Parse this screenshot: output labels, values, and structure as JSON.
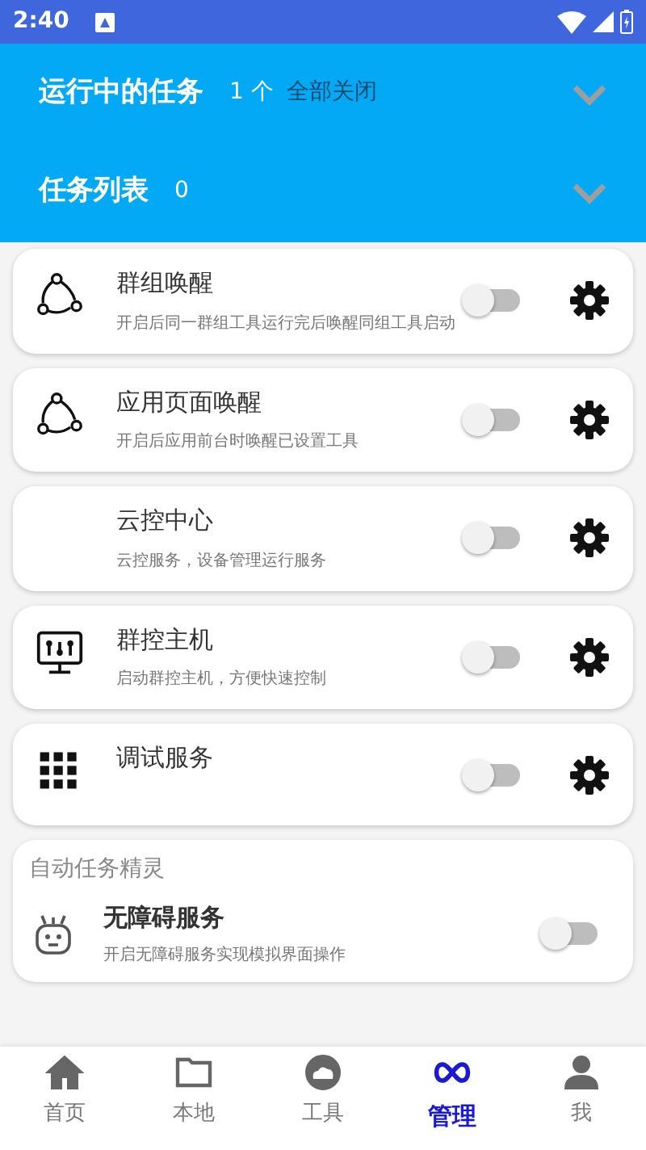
{
  "status_bar": {
    "time": "2:40"
  },
  "header": {
    "running": {
      "title": "运行中的任务",
      "count": "1 个",
      "action": "全部关闭",
      "expanded": false
    },
    "task_list": {
      "title": "任务列表",
      "count": "0",
      "expanded": false
    }
  },
  "services": [
    {
      "title": "群组唤醒",
      "description": "开启后同一群组工具运行完后唤醒同组工具启动",
      "on": false
    },
    {
      "title": "应用页面唤醒",
      "description": "开启后应用前台时唤醒已设置工具",
      "on": false
    },
    {
      "title": "云控中心",
      "description": "云控服务，设备管理运行服务",
      "on": false
    },
    {
      "title": "群控主机",
      "description": "启动群控主机，方便快速控制",
      "on": false
    },
    {
      "title": "调试服务",
      "on": false
    }
  ],
  "section": {
    "title": "自动任务精灵",
    "items": [
      {
        "title": "无障碍服务",
        "description": "开启无障碍服务实现模拟界面操作",
        "on": false
      }
    ]
  },
  "bottom_nav": [
    {
      "label": "首页",
      "selected": false
    },
    {
      "label": "本地",
      "selected": false
    },
    {
      "label": "工具",
      "selected": false
    },
    {
      "label": "管理",
      "selected": true
    },
    {
      "label": "我",
      "selected": false
    }
  ]
}
